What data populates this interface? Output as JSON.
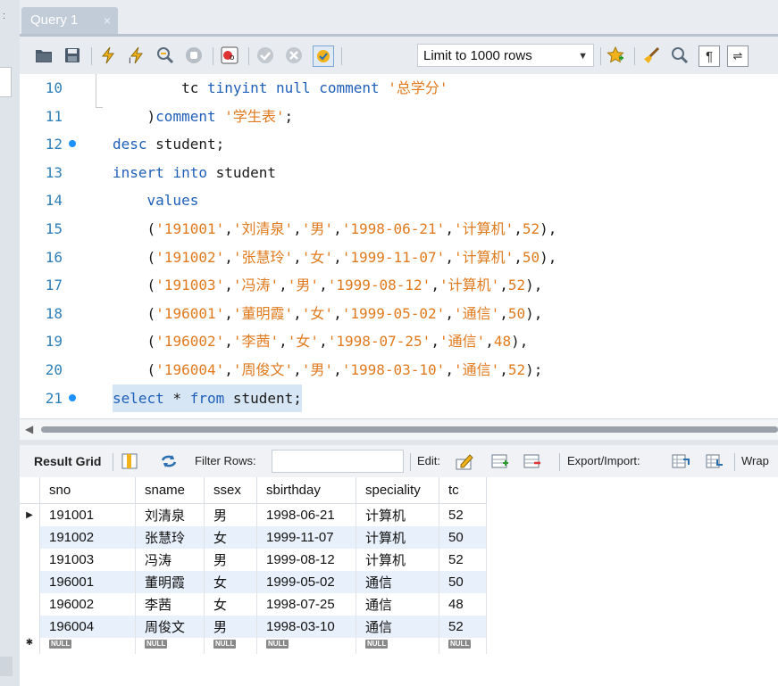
{
  "tab": {
    "label": "Query 1",
    "close": "×"
  },
  "toolbar": {
    "limit_label": "Limit to 1000 rows"
  },
  "editor": {
    "lines": [
      {
        "num": "10",
        "dot": false,
        "sel": false,
        "parts": [
          [
            "plain",
            "        tc "
          ],
          [
            "kw",
            "tinyint"
          ],
          [
            "plain",
            " "
          ],
          [
            "kw",
            "null"
          ],
          [
            "plain",
            " "
          ],
          [
            "kw",
            "comment"
          ],
          [
            "plain",
            " "
          ],
          [
            "str",
            "'总学分'"
          ]
        ]
      },
      {
        "num": "11",
        "dot": false,
        "sel": false,
        "parts": [
          [
            "plain",
            "    )"
          ],
          [
            "kw",
            "comment"
          ],
          [
            "plain",
            " "
          ],
          [
            "str",
            "'学生表'"
          ],
          [
            "plain",
            ";"
          ]
        ]
      },
      {
        "num": "12",
        "dot": true,
        "sel": false,
        "parts": [
          [
            "kw",
            "desc"
          ],
          [
            "plain",
            " student;"
          ]
        ]
      },
      {
        "num": "13",
        "dot": false,
        "sel": false,
        "parts": [
          [
            "kw",
            "insert"
          ],
          [
            "plain",
            " "
          ],
          [
            "kw",
            "into"
          ],
          [
            "plain",
            " student"
          ]
        ]
      },
      {
        "num": "14",
        "dot": false,
        "sel": false,
        "parts": [
          [
            "plain",
            "    "
          ],
          [
            "kw",
            "values"
          ]
        ]
      },
      {
        "num": "15",
        "dot": false,
        "sel": false,
        "parts": [
          [
            "plain",
            "    ("
          ],
          [
            "str",
            "'191001'"
          ],
          [
            "plain",
            ","
          ],
          [
            "str",
            "'刘清泉'"
          ],
          [
            "plain",
            ","
          ],
          [
            "str",
            "'男'"
          ],
          [
            "plain",
            ","
          ],
          [
            "str",
            "'1998-06-21'"
          ],
          [
            "plain",
            ","
          ],
          [
            "str",
            "'计算机'"
          ],
          [
            "plain",
            ","
          ],
          [
            "str",
            "52"
          ],
          [
            "plain",
            "),"
          ]
        ]
      },
      {
        "num": "16",
        "dot": false,
        "sel": false,
        "parts": [
          [
            "plain",
            "    ("
          ],
          [
            "str",
            "'191002'"
          ],
          [
            "plain",
            ","
          ],
          [
            "str",
            "'张慧玲'"
          ],
          [
            "plain",
            ","
          ],
          [
            "str",
            "'女'"
          ],
          [
            "plain",
            ","
          ],
          [
            "str",
            "'1999-11-07'"
          ],
          [
            "plain",
            ","
          ],
          [
            "str",
            "'计算机'"
          ],
          [
            "plain",
            ","
          ],
          [
            "str",
            "50"
          ],
          [
            "plain",
            "),"
          ]
        ]
      },
      {
        "num": "17",
        "dot": false,
        "sel": false,
        "parts": [
          [
            "plain",
            "    ("
          ],
          [
            "str",
            "'191003'"
          ],
          [
            "plain",
            ","
          ],
          [
            "str",
            "'冯涛'"
          ],
          [
            "plain",
            ","
          ],
          [
            "str",
            "'男'"
          ],
          [
            "plain",
            ","
          ],
          [
            "str",
            "'1999-08-12'"
          ],
          [
            "plain",
            ","
          ],
          [
            "str",
            "'计算机'"
          ],
          [
            "plain",
            ","
          ],
          [
            "str",
            "52"
          ],
          [
            "plain",
            "),"
          ]
        ]
      },
      {
        "num": "18",
        "dot": false,
        "sel": false,
        "parts": [
          [
            "plain",
            "    ("
          ],
          [
            "str",
            "'196001'"
          ],
          [
            "plain",
            ","
          ],
          [
            "str",
            "'董明霞'"
          ],
          [
            "plain",
            ","
          ],
          [
            "str",
            "'女'"
          ],
          [
            "plain",
            ","
          ],
          [
            "str",
            "'1999-05-02'"
          ],
          [
            "plain",
            ","
          ],
          [
            "str",
            "'通信'"
          ],
          [
            "plain",
            ","
          ],
          [
            "str",
            "50"
          ],
          [
            "plain",
            "),"
          ]
        ]
      },
      {
        "num": "19",
        "dot": false,
        "sel": false,
        "parts": [
          [
            "plain",
            "    ("
          ],
          [
            "str",
            "'196002'"
          ],
          [
            "plain",
            ","
          ],
          [
            "str",
            "'李茜'"
          ],
          [
            "plain",
            ","
          ],
          [
            "str",
            "'女'"
          ],
          [
            "plain",
            ","
          ],
          [
            "str",
            "'1998-07-25'"
          ],
          [
            "plain",
            ","
          ],
          [
            "str",
            "'通信'"
          ],
          [
            "plain",
            ","
          ],
          [
            "str",
            "48"
          ],
          [
            "plain",
            "),"
          ]
        ]
      },
      {
        "num": "20",
        "dot": false,
        "sel": false,
        "parts": [
          [
            "plain",
            "    ("
          ],
          [
            "str",
            "'196004'"
          ],
          [
            "plain",
            ","
          ],
          [
            "str",
            "'周俊文'"
          ],
          [
            "plain",
            ","
          ],
          [
            "str",
            "'男'"
          ],
          [
            "plain",
            ","
          ],
          [
            "str",
            "'1998-03-10'"
          ],
          [
            "plain",
            ","
          ],
          [
            "str",
            "'通信'"
          ],
          [
            "plain",
            ","
          ],
          [
            "str",
            "52"
          ],
          [
            "plain",
            ");"
          ]
        ]
      },
      {
        "num": "21",
        "dot": true,
        "sel": true,
        "parts": [
          [
            "kw",
            "select"
          ],
          [
            "plain",
            " * "
          ],
          [
            "kw",
            "from"
          ],
          [
            "plain",
            " student;"
          ]
        ]
      }
    ]
  },
  "result_toolbar": {
    "result_grid": "Result Grid",
    "filter_rows": "Filter Rows:",
    "edit": "Edit:",
    "export_import": "Export/Import:",
    "wrap": "Wrap"
  },
  "grid": {
    "columns": [
      "sno",
      "sname",
      "ssex",
      "sbirthday",
      "speciality",
      "tc"
    ],
    "rows": [
      [
        "191001",
        "刘清泉",
        "男",
        "1998-06-21",
        "计算机",
        "52"
      ],
      [
        "191002",
        "张慧玲",
        "女",
        "1999-11-07",
        "计算机",
        "50"
      ],
      [
        "191003",
        "冯涛",
        "男",
        "1999-08-12",
        "计算机",
        "52"
      ],
      [
        "196001",
        "董明霞",
        "女",
        "1999-05-02",
        "通信",
        "50"
      ],
      [
        "196002",
        "李茜",
        "女",
        "1998-07-25",
        "通信",
        "48"
      ],
      [
        "196004",
        "周俊文",
        "男",
        "1998-03-10",
        "通信",
        "52"
      ]
    ],
    "null_label": "NULL"
  }
}
